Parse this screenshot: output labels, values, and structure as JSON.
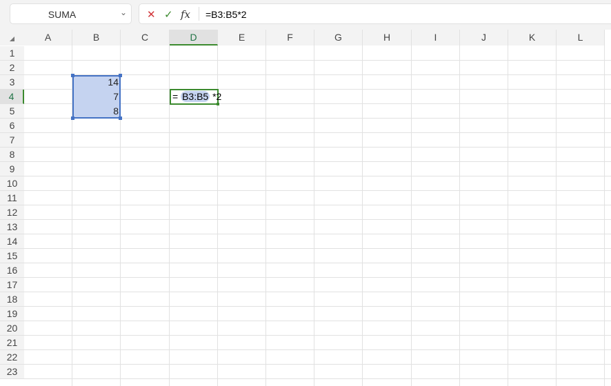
{
  "name_box": {
    "value": "SUMA"
  },
  "formula_bar": {
    "cancel_icon": "✕",
    "enter_icon": "✓",
    "fx_label": "fx",
    "formula": "=B3:B5*2"
  },
  "columns": [
    "A",
    "B",
    "C",
    "D",
    "E",
    "F",
    "G",
    "H",
    "I",
    "J",
    "K",
    "L"
  ],
  "rows": [
    "1",
    "2",
    "3",
    "4",
    "5",
    "6",
    "7",
    "8",
    "9",
    "10",
    "11",
    "12",
    "13",
    "14",
    "15",
    "16",
    "17",
    "18",
    "19",
    "20",
    "21",
    "22",
    "23"
  ],
  "cells": {
    "B3": "14",
    "B4": "7",
    "B5": "8"
  },
  "edit_cell": {
    "eq": "=",
    "ref": "B3:B5",
    "rest": "*2"
  },
  "colors": {
    "accent": "#3b8a2e",
    "range": "#4472c4",
    "range_fill": "#c5d3f0"
  }
}
